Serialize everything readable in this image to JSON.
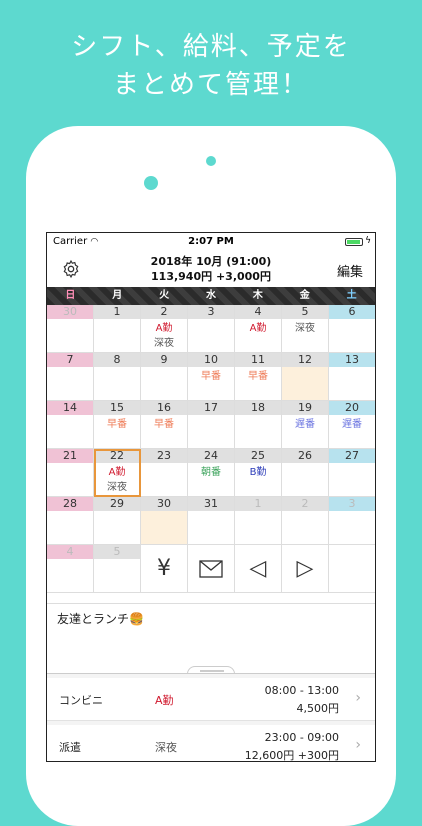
{
  "promo": {
    "line1": "シフト、給料、予定を",
    "line2": "まとめて管理！"
  },
  "status": {
    "carrier": "Carrier",
    "time": "2:07 PM"
  },
  "header": {
    "title_line1": "2018年 10月 (91:00)",
    "title_line2": "113,940円 +3,000円",
    "edit_label": "編集"
  },
  "weekdays": [
    "日",
    "月",
    "火",
    "水",
    "木",
    "金",
    "土"
  ],
  "weeks": [
    [
      {
        "n": "30",
        "dim": true
      },
      {
        "n": "1"
      },
      {
        "n": "2",
        "s1": "A勤",
        "c1": "red",
        "s2": "深夜"
      },
      {
        "n": "3"
      },
      {
        "n": "4",
        "s1": "A勤",
        "c1": "red"
      },
      {
        "n": "5",
        "s1": "深夜",
        "c1": "gray"
      },
      {
        "n": "6"
      }
    ],
    [
      {
        "n": "7"
      },
      {
        "n": "8"
      },
      {
        "n": "9"
      },
      {
        "n": "10",
        "s1": "早番",
        "c1": "orange"
      },
      {
        "n": "11",
        "s1": "早番",
        "c1": "orange"
      },
      {
        "n": "12",
        "hl": true
      },
      {
        "n": "13"
      }
    ],
    [
      {
        "n": "14"
      },
      {
        "n": "15",
        "s1": "早番",
        "c1": "orange"
      },
      {
        "n": "16",
        "s1": "早番",
        "c1": "orange"
      },
      {
        "n": "17"
      },
      {
        "n": "18"
      },
      {
        "n": "19",
        "s1": "遅番",
        "c1": "blue"
      },
      {
        "n": "20",
        "s1": "遅番",
        "c1": "blue"
      }
    ],
    [
      {
        "n": "21"
      },
      {
        "n": "22",
        "s1": "A勤",
        "c1": "red",
        "s2": "深夜",
        "today": true
      },
      {
        "n": "23"
      },
      {
        "n": "24",
        "s1": "朝番",
        "c1": "green"
      },
      {
        "n": "25",
        "s1": "B勤",
        "c1": "navy"
      },
      {
        "n": "26"
      },
      {
        "n": "27"
      }
    ],
    [
      {
        "n": "28"
      },
      {
        "n": "29"
      },
      {
        "n": "30",
        "hl": true
      },
      {
        "n": "31"
      },
      {
        "n": "1",
        "dim": true
      },
      {
        "n": "2",
        "dim": true
      },
      {
        "n": "3",
        "dim": true
      }
    ],
    [
      {
        "n": "4",
        "dim": true
      },
      {
        "n": "5",
        "dim": true
      }
    ]
  ],
  "toolbar": {
    "yen_icon": "¥",
    "mail_icon": "mail-icon",
    "prev_icon": "◁",
    "next_icon": "▷"
  },
  "memo": "友達とランチ🍔",
  "shifts": [
    {
      "name": "コンビニ",
      "type": "A勤",
      "time": "08:00 - 13:00",
      "pay": "4,500円",
      "color": "#d0192e"
    },
    {
      "name": "派遣",
      "type": "深夜",
      "time": "23:00 - 09:00",
      "pay": "12,600円 +300円",
      "color": "#555555"
    }
  ]
}
